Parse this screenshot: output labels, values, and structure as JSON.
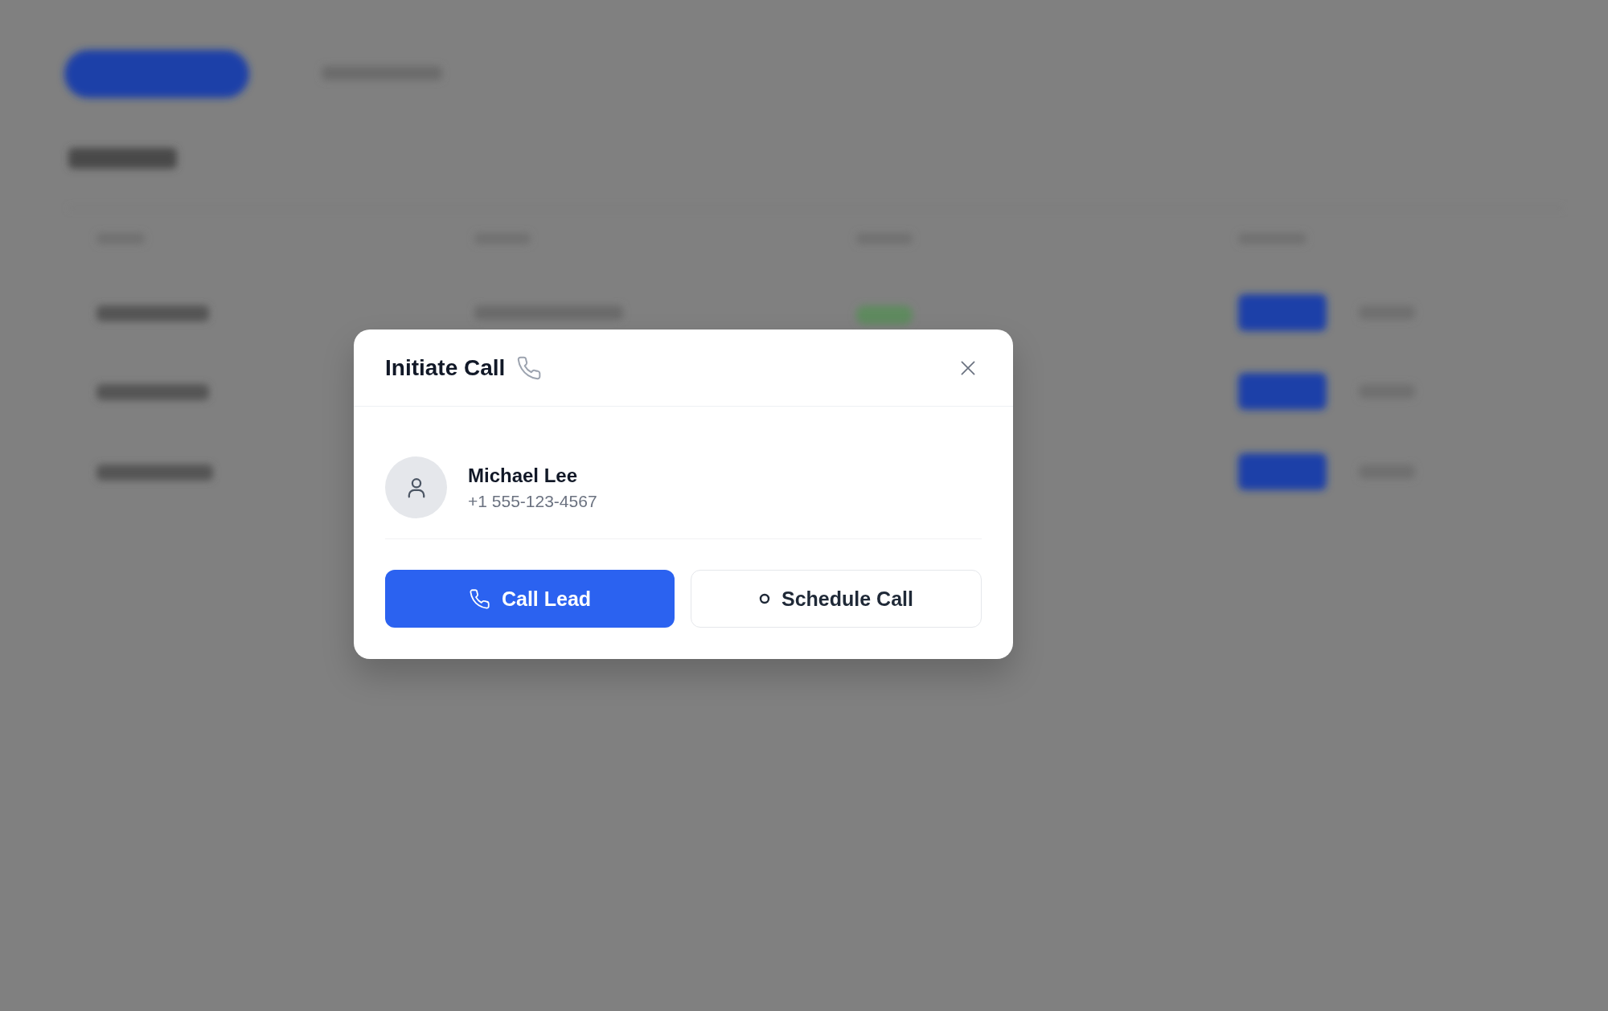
{
  "dialog": {
    "title": "Initiate Call",
    "contact": {
      "name": "Michael Lee",
      "phone": "+1 555-123-4567"
    },
    "buttons": [
      {
        "label": "Call Lead",
        "kind": "primary"
      },
      {
        "label": "Schedule Call",
        "kind": "secondary"
      }
    ]
  }
}
